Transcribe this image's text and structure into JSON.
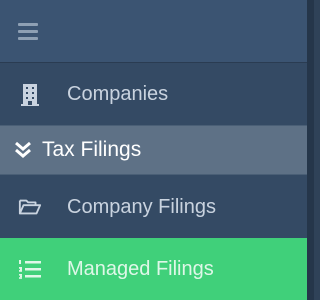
{
  "sidebar": {
    "toggle": {
      "icon": "hamburger-menu-icon"
    },
    "items": [
      {
        "label": "Companies",
        "icon": "building-icon"
      },
      {
        "label": "Tax Filings",
        "icon": "double-chevron-down-icon",
        "expanded": true
      },
      {
        "label": "Company Filings",
        "icon": "folder-open-icon"
      },
      {
        "label": "Managed Filings",
        "icon": "ordered-list-icon",
        "active": true
      }
    ],
    "colors": {
      "background": "#344a64",
      "section_header": "#5e7186",
      "active": "#40d07a",
      "text": "#c9d3df"
    }
  }
}
